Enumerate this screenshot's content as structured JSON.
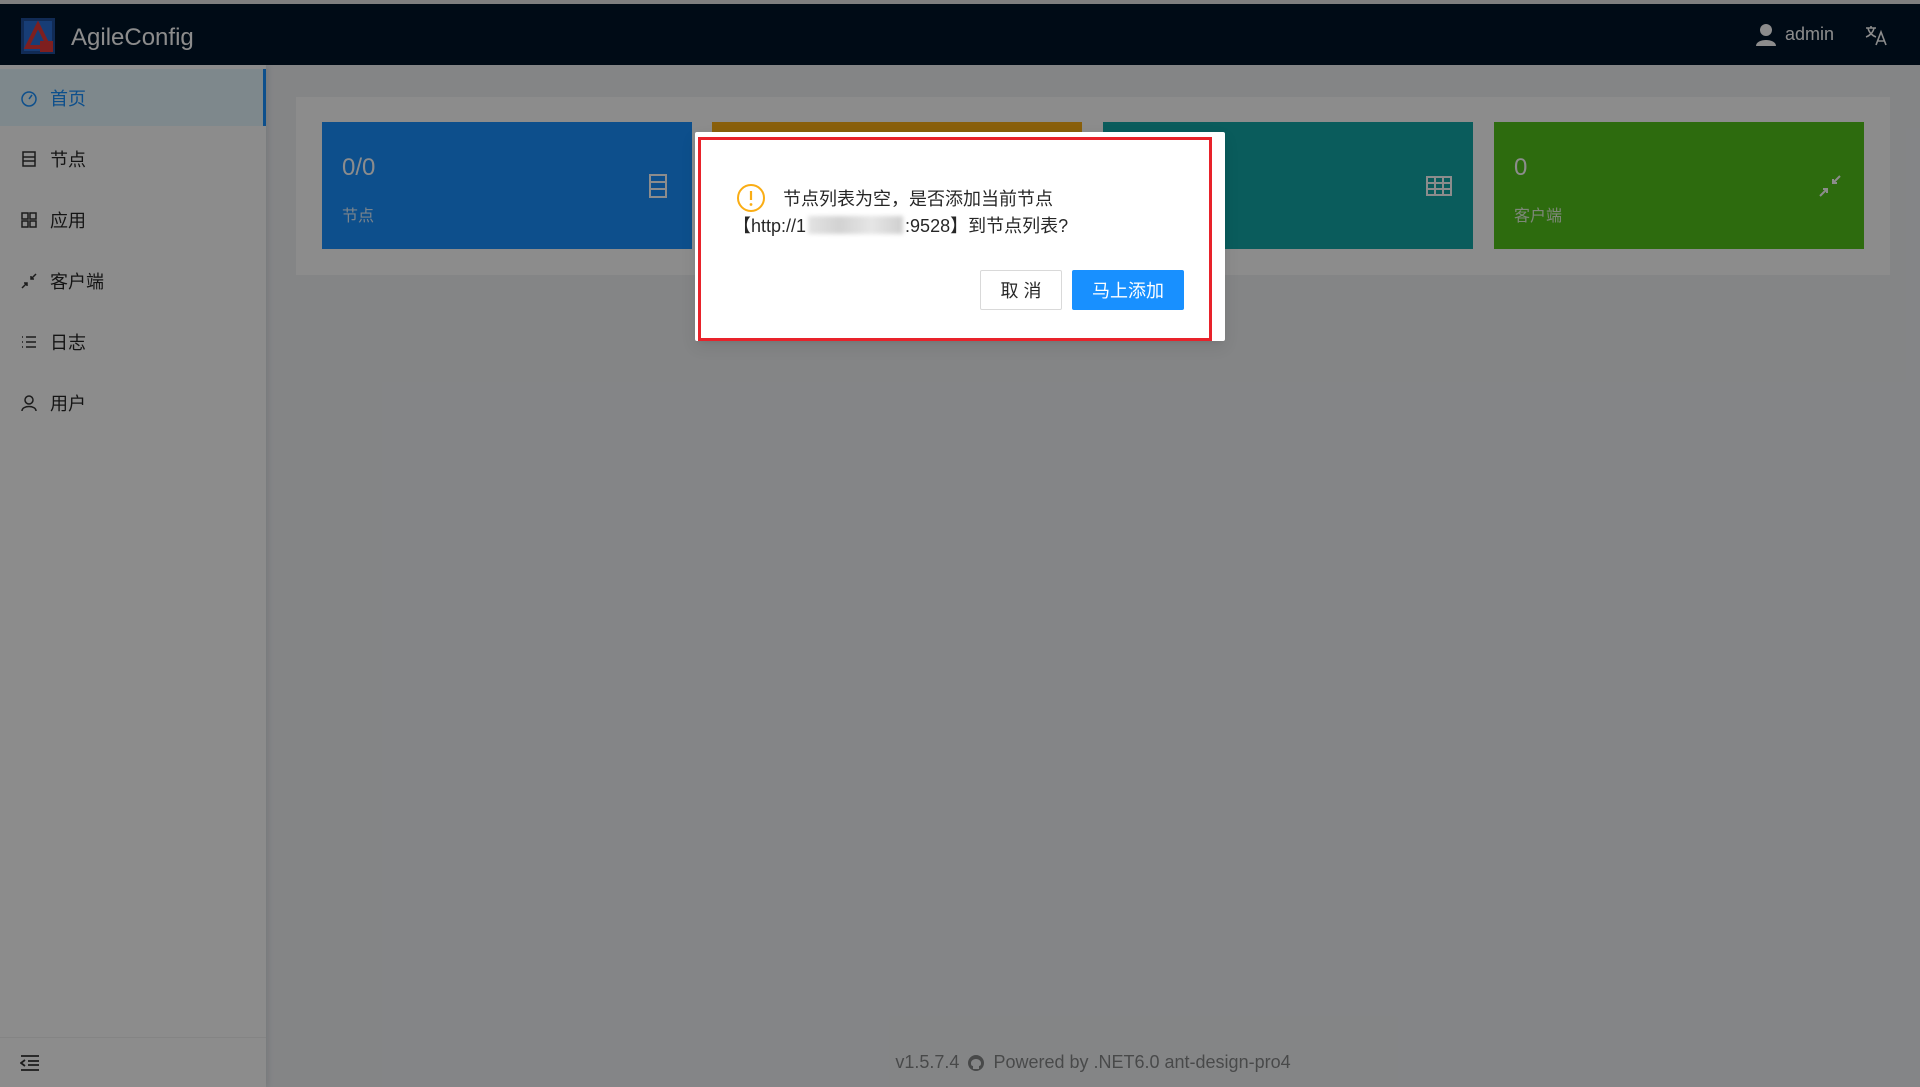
{
  "header": {
    "app_title": "AgileConfig",
    "username": "admin",
    "logo_icon": "agileconfig-logo-icon",
    "user_icon": "user-icon",
    "lang_icon": "translate-icon"
  },
  "sidebar": {
    "items": [
      {
        "label": "首页",
        "icon": "dashboard-icon",
        "active": true
      },
      {
        "label": "节点",
        "icon": "node-icon"
      },
      {
        "label": "应用",
        "icon": "app-grid-icon"
      },
      {
        "label": "客户端",
        "icon": "client-icon"
      },
      {
        "label": "日志",
        "icon": "log-icon"
      },
      {
        "label": "用户",
        "icon": "user-icon"
      }
    ],
    "collapse_icon": "menu-fold-icon"
  },
  "cards": [
    {
      "value": "0/0",
      "label": "节点",
      "color": "#1890ff",
      "icon": "server-icon"
    },
    {
      "value": "",
      "label": "",
      "color": "#faad14",
      "icon": ""
    },
    {
      "value": "",
      "label": "",
      "color": "#13a8a8",
      "icon": "table-icon"
    },
    {
      "value": "0",
      "label": "客户端",
      "color": "#52c41a",
      "icon": "shrink-icon"
    }
  ],
  "footer": {
    "version": "v1.5.7.4",
    "powered_by": "Powered by .NET6.0 ant-design-pro4",
    "github_icon": "github-icon"
  },
  "modal": {
    "icon": "exclamation-circle-icon",
    "message_line1": "节点列表为空，是否添加当前节点",
    "message_prefix": "【http://1",
    "message_suffix": ":9528】到节点列表?",
    "cancel_label": "取 消",
    "ok_label": "马上添加"
  },
  "colors": {
    "primary": "#1890ff",
    "warning": "#faad14",
    "highlight_border": "#e8222a",
    "header_bg": "#001529"
  }
}
